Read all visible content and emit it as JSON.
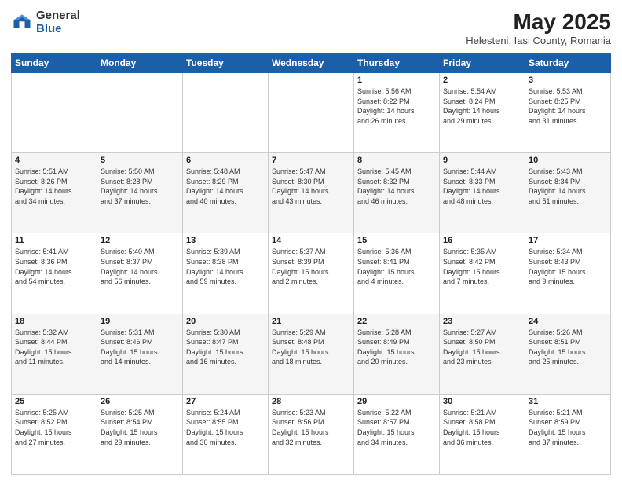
{
  "logo": {
    "general": "General",
    "blue": "Blue"
  },
  "header": {
    "title": "May 2025",
    "subtitle": "Helesteni, Iasi County, Romania"
  },
  "weekdays": [
    "Sunday",
    "Monday",
    "Tuesday",
    "Wednesday",
    "Thursday",
    "Friday",
    "Saturday"
  ],
  "weeks": [
    [
      {
        "day": "",
        "info": ""
      },
      {
        "day": "",
        "info": ""
      },
      {
        "day": "",
        "info": ""
      },
      {
        "day": "",
        "info": ""
      },
      {
        "day": "1",
        "info": "Sunrise: 5:56 AM\nSunset: 8:22 PM\nDaylight: 14 hours\nand 26 minutes."
      },
      {
        "day": "2",
        "info": "Sunrise: 5:54 AM\nSunset: 8:24 PM\nDaylight: 14 hours\nand 29 minutes."
      },
      {
        "day": "3",
        "info": "Sunrise: 5:53 AM\nSunset: 8:25 PM\nDaylight: 14 hours\nand 31 minutes."
      }
    ],
    [
      {
        "day": "4",
        "info": "Sunrise: 5:51 AM\nSunset: 8:26 PM\nDaylight: 14 hours\nand 34 minutes."
      },
      {
        "day": "5",
        "info": "Sunrise: 5:50 AM\nSunset: 8:28 PM\nDaylight: 14 hours\nand 37 minutes."
      },
      {
        "day": "6",
        "info": "Sunrise: 5:48 AM\nSunset: 8:29 PM\nDaylight: 14 hours\nand 40 minutes."
      },
      {
        "day": "7",
        "info": "Sunrise: 5:47 AM\nSunset: 8:30 PM\nDaylight: 14 hours\nand 43 minutes."
      },
      {
        "day": "8",
        "info": "Sunrise: 5:45 AM\nSunset: 8:32 PM\nDaylight: 14 hours\nand 46 minutes."
      },
      {
        "day": "9",
        "info": "Sunrise: 5:44 AM\nSunset: 8:33 PM\nDaylight: 14 hours\nand 48 minutes."
      },
      {
        "day": "10",
        "info": "Sunrise: 5:43 AM\nSunset: 8:34 PM\nDaylight: 14 hours\nand 51 minutes."
      }
    ],
    [
      {
        "day": "11",
        "info": "Sunrise: 5:41 AM\nSunset: 8:36 PM\nDaylight: 14 hours\nand 54 minutes."
      },
      {
        "day": "12",
        "info": "Sunrise: 5:40 AM\nSunset: 8:37 PM\nDaylight: 14 hours\nand 56 minutes."
      },
      {
        "day": "13",
        "info": "Sunrise: 5:39 AM\nSunset: 8:38 PM\nDaylight: 14 hours\nand 59 minutes."
      },
      {
        "day": "14",
        "info": "Sunrise: 5:37 AM\nSunset: 8:39 PM\nDaylight: 15 hours\nand 2 minutes."
      },
      {
        "day": "15",
        "info": "Sunrise: 5:36 AM\nSunset: 8:41 PM\nDaylight: 15 hours\nand 4 minutes."
      },
      {
        "day": "16",
        "info": "Sunrise: 5:35 AM\nSunset: 8:42 PM\nDaylight: 15 hours\nand 7 minutes."
      },
      {
        "day": "17",
        "info": "Sunrise: 5:34 AM\nSunset: 8:43 PM\nDaylight: 15 hours\nand 9 minutes."
      }
    ],
    [
      {
        "day": "18",
        "info": "Sunrise: 5:32 AM\nSunset: 8:44 PM\nDaylight: 15 hours\nand 11 minutes."
      },
      {
        "day": "19",
        "info": "Sunrise: 5:31 AM\nSunset: 8:46 PM\nDaylight: 15 hours\nand 14 minutes."
      },
      {
        "day": "20",
        "info": "Sunrise: 5:30 AM\nSunset: 8:47 PM\nDaylight: 15 hours\nand 16 minutes."
      },
      {
        "day": "21",
        "info": "Sunrise: 5:29 AM\nSunset: 8:48 PM\nDaylight: 15 hours\nand 18 minutes."
      },
      {
        "day": "22",
        "info": "Sunrise: 5:28 AM\nSunset: 8:49 PM\nDaylight: 15 hours\nand 20 minutes."
      },
      {
        "day": "23",
        "info": "Sunrise: 5:27 AM\nSunset: 8:50 PM\nDaylight: 15 hours\nand 23 minutes."
      },
      {
        "day": "24",
        "info": "Sunrise: 5:26 AM\nSunset: 8:51 PM\nDaylight: 15 hours\nand 25 minutes."
      }
    ],
    [
      {
        "day": "25",
        "info": "Sunrise: 5:25 AM\nSunset: 8:52 PM\nDaylight: 15 hours\nand 27 minutes."
      },
      {
        "day": "26",
        "info": "Sunrise: 5:25 AM\nSunset: 8:54 PM\nDaylight: 15 hours\nand 29 minutes."
      },
      {
        "day": "27",
        "info": "Sunrise: 5:24 AM\nSunset: 8:55 PM\nDaylight: 15 hours\nand 30 minutes."
      },
      {
        "day": "28",
        "info": "Sunrise: 5:23 AM\nSunset: 8:56 PM\nDaylight: 15 hours\nand 32 minutes."
      },
      {
        "day": "29",
        "info": "Sunrise: 5:22 AM\nSunset: 8:57 PM\nDaylight: 15 hours\nand 34 minutes."
      },
      {
        "day": "30",
        "info": "Sunrise: 5:21 AM\nSunset: 8:58 PM\nDaylight: 15 hours\nand 36 minutes."
      },
      {
        "day": "31",
        "info": "Sunrise: 5:21 AM\nSunset: 8:59 PM\nDaylight: 15 hours\nand 37 minutes."
      }
    ]
  ]
}
